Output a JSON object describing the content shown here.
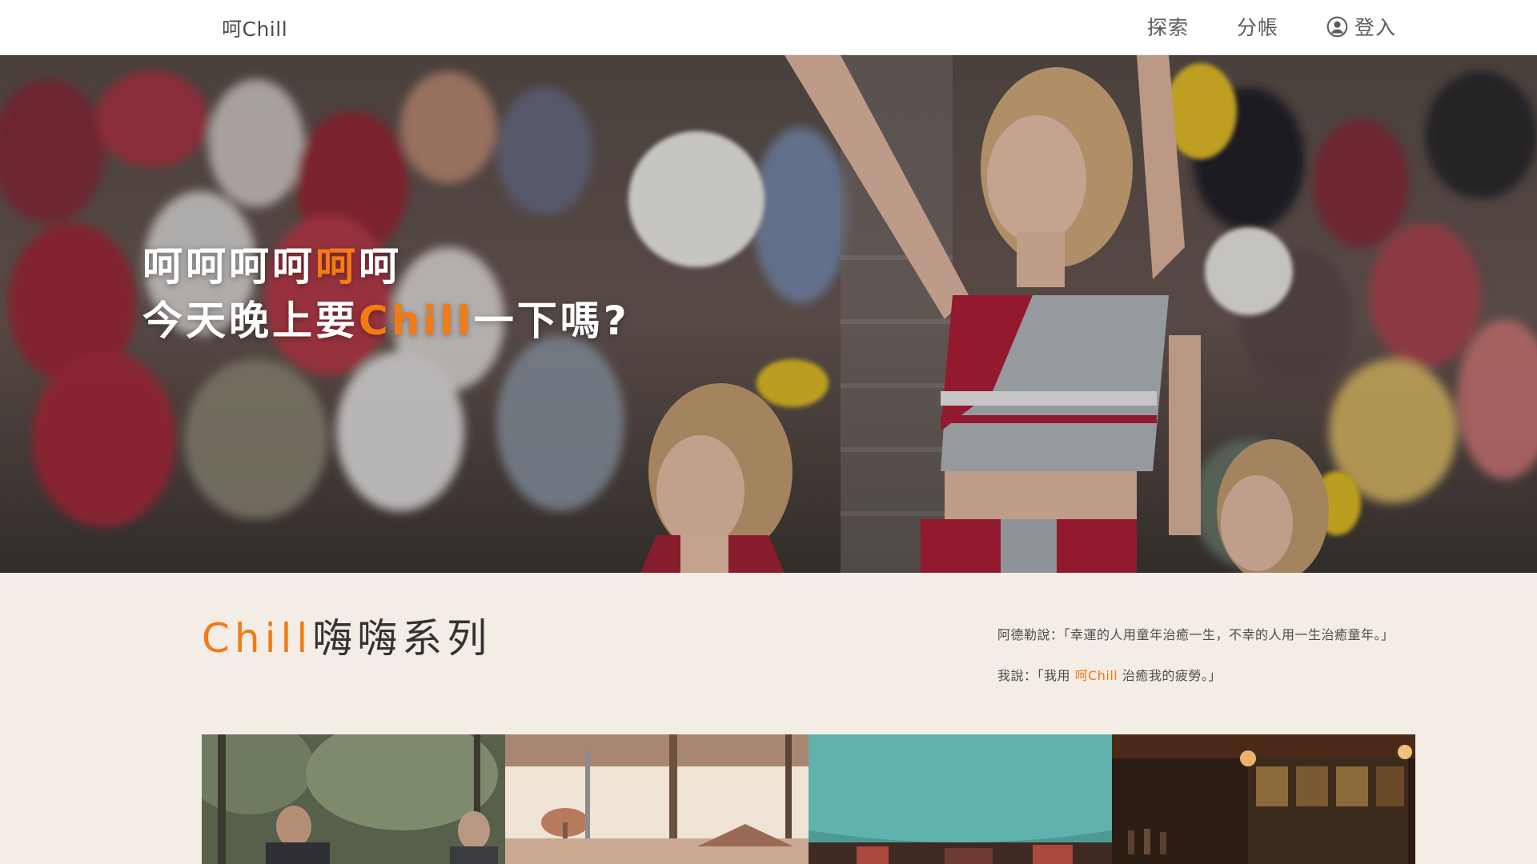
{
  "nav": {
    "brand": "呵Chill",
    "links": [
      "探索",
      "分帳"
    ],
    "login": "登入"
  },
  "hero": {
    "line1_pre": "呵呵呵呵",
    "line1_accent": "呵",
    "line1_post": "呵",
    "line2_pre": "今天晚上要",
    "line2_accent": "Chill",
    "line2_post": "一下嗎?"
  },
  "series": {
    "title_accent": "Chill",
    "title_rest": "嗨嗨系列",
    "quote1": "阿德勒說：「幸運的人用童年治癒一生，不幸的人用一生治癒童年。」",
    "quote2_pre": "我說：「我用 ",
    "quote2_accent": "呵Chill",
    "quote2_post": " 治癒我的疲勞。」"
  },
  "gallery": {
    "tiles": [
      "outdoor-people-photo",
      "palm-trees-photo",
      "tent-canopy-photo",
      "bar-interior-photo"
    ]
  },
  "colors": {
    "accent": "#f37a14",
    "section_bg": "#f3ede6",
    "nav_bg": "#ffffff"
  }
}
